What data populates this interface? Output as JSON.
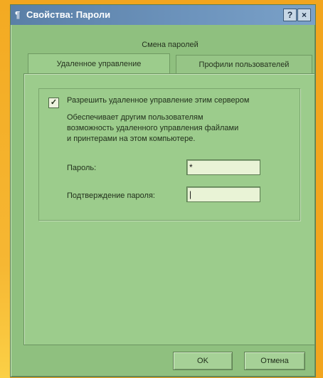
{
  "window": {
    "title": "Свойства: Пароли",
    "help_label": "?",
    "close_label": "×"
  },
  "tabs": {
    "top": "Смена паролей",
    "active": "Удаленное управление",
    "inactive": "Профили пользователей"
  },
  "remote": {
    "checkbox_checked": true,
    "checkbox_label": "Разрешить удаленное управление этим сервером",
    "description": [
      "Обеспечивает другим пользователям",
      "возможность удаленного управления файлами",
      "и принтерами на этом компьютере."
    ],
    "password_label": "Пароль:",
    "password_value": "*",
    "confirm_label": "Подтверждение пароля:",
    "confirm_value": "|"
  },
  "buttons": {
    "ok": "OK",
    "cancel": "Отмена"
  }
}
